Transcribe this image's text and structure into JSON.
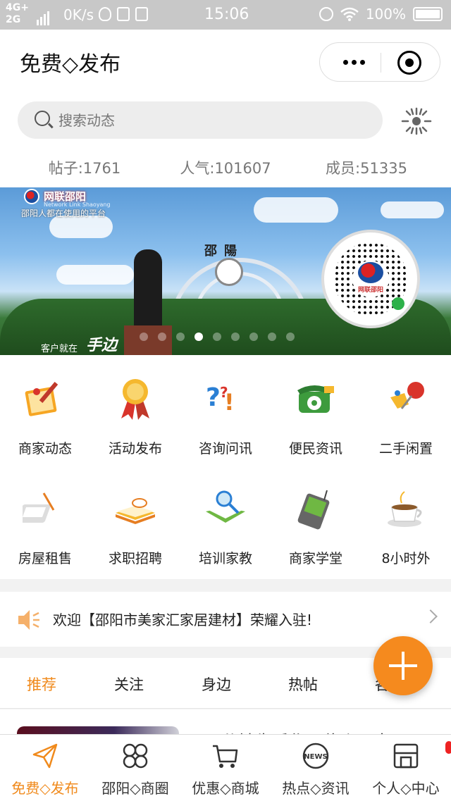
{
  "status_bar": {
    "network_top": "4G+",
    "network_bottom": "2G",
    "speed": "0K/s",
    "time": "15:06",
    "battery": "100%"
  },
  "header": {
    "title": "免费◇发布"
  },
  "search": {
    "placeholder": "搜索动态"
  },
  "stats": [
    {
      "label": "帖子:1761"
    },
    {
      "label": "人气:101607"
    },
    {
      "label": "成员:51335"
    }
  ],
  "banner": {
    "brand": "网联邵阳",
    "brand_en": "Network Link Shaoyang",
    "brand_sub": "邵阳人都在使用的平台",
    "station": "邵陽",
    "slogan": "客户就在",
    "slogan_big": "手边",
    "qr_label": "网联邵阳",
    "slide_count": 9,
    "active_slide": 1
  },
  "menu": [
    {
      "label": "商家动态",
      "icon": "notepad-pen-icon"
    },
    {
      "label": "活动发布",
      "icon": "award-ribbon-icon"
    },
    {
      "label": "咨询问讯",
      "icon": "question-marks-icon"
    },
    {
      "label": "便民资讯",
      "icon": "telephone-icon"
    },
    {
      "label": "二手闲置",
      "icon": "pushpin-icon"
    },
    {
      "label": "房屋租售",
      "icon": "tablet-stylus-icon"
    },
    {
      "label": "求职招聘",
      "icon": "open-book-icon"
    },
    {
      "label": "培训家教",
      "icon": "magnifier-book-icon"
    },
    {
      "label": "商家学堂",
      "icon": "pda-device-icon"
    },
    {
      "label": "8小时外",
      "icon": "coffee-cup-icon"
    }
  ],
  "notice": {
    "text": "欢迎【邵阳市美家汇家居建材】荣耀入驻!"
  },
  "tabs": [
    {
      "label": "推荐",
      "active": true
    },
    {
      "label": "关注",
      "active": false
    },
    {
      "label": "身边",
      "active": false
    },
    {
      "label": "热帖",
      "active": false
    },
    {
      "label": "各",
      "active": false
    }
  ],
  "peek": {
    "text": "三分钟先后作一位乡居大"
  },
  "bottom_nav": [
    {
      "label": "免费◇发布",
      "icon": "paper-plane-icon",
      "active": true
    },
    {
      "label": "邵阳◇商圈",
      "icon": "clover-icon",
      "active": false
    },
    {
      "label": "优惠◇商城",
      "icon": "shopping-cart-icon",
      "active": false
    },
    {
      "label": "热点◇资讯",
      "icon": "news-icon",
      "active": false
    },
    {
      "label": "个人◇中心",
      "icon": "storefront-icon",
      "active": false
    }
  ],
  "colors": {
    "accent": "#f08a1c",
    "fab": "#f58a1e",
    "status_bar": "#c8c8c8"
  }
}
